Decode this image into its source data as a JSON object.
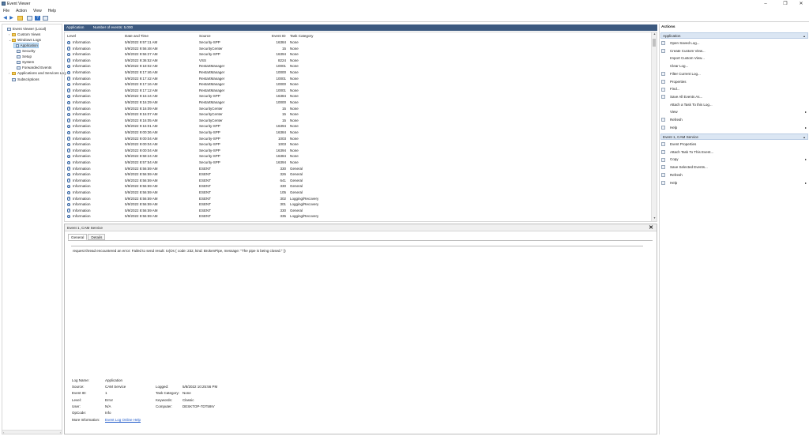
{
  "window": {
    "title": "Event Viewer",
    "controls": {
      "minimize": "–",
      "maximize": "❐",
      "close": "✕"
    }
  },
  "menu": [
    "File",
    "Action",
    "View",
    "Help"
  ],
  "tree": {
    "nodes": [
      {
        "label": "Event Viewer (Local)",
        "level": 0,
        "twisty": "",
        "icon": "log"
      },
      {
        "label": "Custom Views",
        "level": 1,
        "twisty": "›",
        "icon": "folder"
      },
      {
        "label": "Windows Logs",
        "level": 1,
        "twisty": "⌄",
        "icon": "folder"
      },
      {
        "label": "Application",
        "level": 2,
        "twisty": "",
        "icon": "log",
        "selected": true
      },
      {
        "label": "Security",
        "level": 2,
        "twisty": "",
        "icon": "log"
      },
      {
        "label": "Setup",
        "level": 2,
        "twisty": "",
        "icon": "log"
      },
      {
        "label": "System",
        "level": 2,
        "twisty": "",
        "icon": "log"
      },
      {
        "label": "Forwarded Events",
        "level": 2,
        "twisty": "",
        "icon": "log"
      },
      {
        "label": "Applications and Services Log",
        "level": 1,
        "twisty": "›",
        "icon": "folder"
      },
      {
        "label": "Subscriptions",
        "level": 1,
        "twisty": "",
        "icon": "log"
      }
    ],
    "scroll_left": "‹",
    "scroll_right": "›"
  },
  "log_header": {
    "name": "Application",
    "count": "Number of events: 5,000"
  },
  "columns": [
    "Level",
    "Date and Time",
    "Source",
    "Event ID",
    "Task Category"
  ],
  "events": [
    {
      "level": "Information",
      "date": "5/9/2022 9:57:11 AM",
      "source": "Security-SPP",
      "id": "16384",
      "task": "None"
    },
    {
      "level": "Information",
      "date": "5/9/2022 9:56:48 AM",
      "source": "SecurityCenter",
      "id": "15",
      "task": "None"
    },
    {
      "level": "Information",
      "date": "5/9/2022 9:56:27 AM",
      "source": "Security-SPP",
      "id": "16394",
      "task": "None"
    },
    {
      "level": "Information",
      "date": "5/9/2022 9:36:52 AM",
      "source": "VSS",
      "id": "8224",
      "task": "None"
    },
    {
      "level": "Information",
      "date": "5/9/2022 9:18:02 AM",
      "source": "RestartManager",
      "id": "10001",
      "task": "None"
    },
    {
      "level": "Information",
      "date": "5/9/2022 9:17:46 AM",
      "source": "RestartManager",
      "id": "10000",
      "task": "None"
    },
    {
      "level": "Information",
      "date": "5/9/2022 9:17:42 AM",
      "source": "RestartManager",
      "id": "10001",
      "task": "None"
    },
    {
      "level": "Information",
      "date": "5/9/2022 9:17:16 AM",
      "source": "RestartManager",
      "id": "10000",
      "task": "None"
    },
    {
      "level": "Information",
      "date": "5/9/2022 9:17:12 AM",
      "source": "RestartManager",
      "id": "10001",
      "task": "None"
    },
    {
      "level": "Information",
      "date": "5/9/2022 9:16:44 AM",
      "source": "Security-SPP",
      "id": "16384",
      "task": "None"
    },
    {
      "level": "Information",
      "date": "5/9/2022 9:16:29 AM",
      "source": "RestartManager",
      "id": "10000",
      "task": "None"
    },
    {
      "level": "Information",
      "date": "5/9/2022 9:16:09 AM",
      "source": "SecurityCenter",
      "id": "15",
      "task": "None"
    },
    {
      "level": "Information",
      "date": "5/9/2022 9:16:07 AM",
      "source": "SecurityCenter",
      "id": "15",
      "task": "None"
    },
    {
      "level": "Information",
      "date": "5/9/2022 9:16:05 AM",
      "source": "SecurityCenter",
      "id": "15",
      "task": "None"
    },
    {
      "level": "Information",
      "date": "5/9/2022 9:16:01 AM",
      "source": "Security-SPP",
      "id": "16394",
      "task": "None"
    },
    {
      "level": "Information",
      "date": "5/9/2022 9:00:36 AM",
      "source": "Security-SPP",
      "id": "16384",
      "task": "None"
    },
    {
      "level": "Information",
      "date": "5/9/2022 9:00:04 AM",
      "source": "Security-SPP",
      "id": "1003",
      "task": "None"
    },
    {
      "level": "Information",
      "date": "5/9/2022 9:00:04 AM",
      "source": "Security-SPP",
      "id": "1003",
      "task": "None"
    },
    {
      "level": "Information",
      "date": "5/9/2022 9:00:04 AM",
      "source": "Security-SPP",
      "id": "16394",
      "task": "None"
    },
    {
      "level": "Information",
      "date": "5/9/2022 8:58:24 AM",
      "source": "Security-SPP",
      "id": "16384",
      "task": "None"
    },
    {
      "level": "Information",
      "date": "5/9/2022 8:57:54 AM",
      "source": "Security-SPP",
      "id": "16394",
      "task": "None"
    },
    {
      "level": "Information",
      "date": "5/9/2022 8:56:59 AM",
      "source": "ESENT",
      "id": "330",
      "task": "General"
    },
    {
      "level": "Information",
      "date": "5/9/2022 8:56:59 AM",
      "source": "ESENT",
      "id": "326",
      "task": "General"
    },
    {
      "level": "Information",
      "date": "5/9/2022 8:56:59 AM",
      "source": "ESENT",
      "id": "641",
      "task": "General"
    },
    {
      "level": "Information",
      "date": "5/9/2022 8:56:59 AM",
      "source": "ESENT",
      "id": "330",
      "task": "General"
    },
    {
      "level": "Information",
      "date": "5/9/2022 8:56:59 AM",
      "source": "ESENT",
      "id": "105",
      "task": "General"
    },
    {
      "level": "Information",
      "date": "5/9/2022 8:56:59 AM",
      "source": "ESENT",
      "id": "302",
      "task": "Logging/Recovery"
    },
    {
      "level": "Information",
      "date": "5/9/2022 8:56:59 AM",
      "source": "ESENT",
      "id": "301",
      "task": "Logging/Recovery"
    },
    {
      "level": "Information",
      "date": "5/9/2022 8:56:59 AM",
      "source": "ESENT",
      "id": "330",
      "task": "General"
    },
    {
      "level": "Information",
      "date": "5/9/2022 8:56:59 AM",
      "source": "ESENT",
      "id": "335",
      "task": "Logging/Recovery"
    }
  ],
  "detail": {
    "title": "Event 1, CAM Service",
    "close": "✕",
    "tabs": [
      "General",
      "Details"
    ],
    "description": "request thread encountered an error: Failed to send result: Io(Os { code: 232, kind: BrokenPipe, message: \"The pipe is being closed.\" })",
    "labels": {
      "log_name": "Log Name:",
      "source": "Source:",
      "event_id": "Event ID:",
      "level": "Level:",
      "user": "User:",
      "opcode": "OpCode:",
      "more_info": "More Information:",
      "logged": "Logged:",
      "task_category": "Task Category:",
      "keywords": "Keywords:",
      "computer": "Computer:"
    },
    "values": {
      "log_name": "Application",
      "source": "CAM Service",
      "event_id": "1",
      "level": "Error",
      "user": "N/A",
      "opcode": "Info",
      "more_info": "Event Log Online Help",
      "logged": "5/8/2022 10:25:56 PM",
      "task_category": "None",
      "keywords": "Classic",
      "computer": "DESKTOP-7DT59IV"
    }
  },
  "actions": {
    "title": "Actions",
    "section1": "Application",
    "section1_items": [
      {
        "label": "Open Saved Log...",
        "icon": "open-log-icon",
        "arrow": ""
      },
      {
        "label": "Create Custom View...",
        "icon": "filter-create-icon",
        "arrow": ""
      },
      {
        "label": "Import Custom View...",
        "icon": "",
        "arrow": ""
      },
      {
        "label": "Clear Log...",
        "icon": "",
        "arrow": ""
      },
      {
        "label": "Filter Current Log...",
        "icon": "filter-icon",
        "arrow": ""
      },
      {
        "label": "Properties",
        "icon": "properties-icon",
        "arrow": ""
      },
      {
        "label": "Find...",
        "icon": "find-icon",
        "arrow": ""
      },
      {
        "label": "Save All Events As...",
        "icon": "save-icon",
        "arrow": ""
      },
      {
        "label": "Attach a Task To this Log...",
        "icon": "",
        "arrow": ""
      },
      {
        "label": "View",
        "icon": "",
        "arrow": "▸"
      },
      {
        "label": "Refresh",
        "icon": "refresh-icon",
        "arrow": ""
      },
      {
        "label": "Help",
        "icon": "help-icon",
        "arrow": "▸"
      }
    ],
    "section2": "Event 1, CAM Service",
    "section2_items": [
      {
        "label": "Event Properties",
        "icon": "event-properties-icon",
        "arrow": ""
      },
      {
        "label": "Attach Task To This Event...",
        "icon": "attach-task-icon",
        "arrow": ""
      },
      {
        "label": "Copy",
        "icon": "copy-icon",
        "arrow": "▸"
      },
      {
        "label": "Save Selected Events...",
        "icon": "save-icon",
        "arrow": ""
      },
      {
        "label": "Refresh",
        "icon": "refresh-icon",
        "arrow": ""
      },
      {
        "label": "Help",
        "icon": "help-icon",
        "arrow": "▸"
      }
    ],
    "caret": "▴"
  },
  "colors": {
    "accent_header": "#3d5a80",
    "selection": "#cde4f7",
    "section": "#dbe6f3",
    "link": "#1a55c8"
  }
}
